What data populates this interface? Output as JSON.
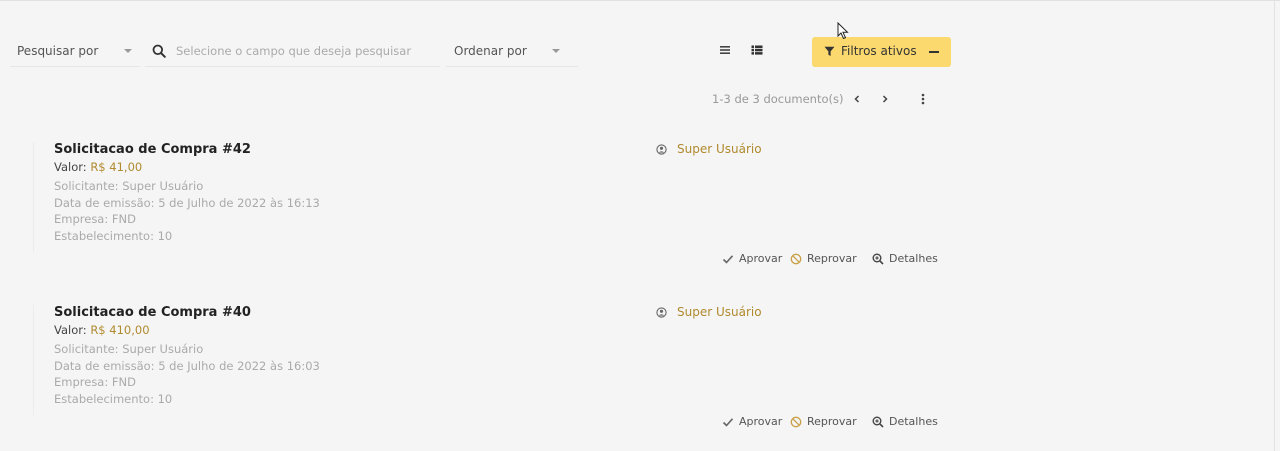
{
  "toolbar": {
    "search_by_label": "Pesquisar por",
    "search_placeholder": "Selecione o campo que deseja pesquisar",
    "order_by_label": "Ordenar por",
    "filter_button_label": "Filtros ativos"
  },
  "pagination": {
    "summary": "1-3 de 3 documento(s)"
  },
  "documents": [
    {
      "title": "Solicitacao de Compra #42",
      "value_label": "Valor:",
      "value": "R$ 41,00",
      "requester": "Solicitante: Super Usuário",
      "issued": "Data de emissão: 5 de Julho de 2022 às 16:13",
      "company": "Empresa: FND",
      "establishment": "Estabelecimento: 10",
      "user": "Super Usuário",
      "actions": {
        "approve": "Aprovar",
        "reject": "Reprovar",
        "details": "Detalhes"
      }
    },
    {
      "title": "Solicitacao de Compra #40",
      "value_label": "Valor:",
      "value": "R$ 410,00",
      "requester": "Solicitante: Super Usuário",
      "issued": "Data de emissão: 5 de Julho de 2022 às 16:03",
      "company": "Empresa: FND",
      "establishment": "Estabelecimento: 10",
      "user": "Super Usuário",
      "actions": {
        "approve": "Aprovar",
        "reject": "Reprovar",
        "details": "Detalhes"
      }
    }
  ],
  "colors": {
    "accent": "#fbd96e",
    "value_text": "#b08a2e",
    "muted_text": "#aaaaaa",
    "background": "#f5f5f5"
  },
  "icons": [
    "search-icon",
    "chevron-down-icon",
    "list-view-icon",
    "detailed-list-view-icon",
    "filter-icon",
    "minus-icon",
    "chevron-left-icon",
    "chevron-right-icon",
    "more-vertical-icon",
    "user-circle-icon",
    "check-icon",
    "block-icon",
    "zoom-in-icon",
    "mouse-cursor-icon"
  ]
}
